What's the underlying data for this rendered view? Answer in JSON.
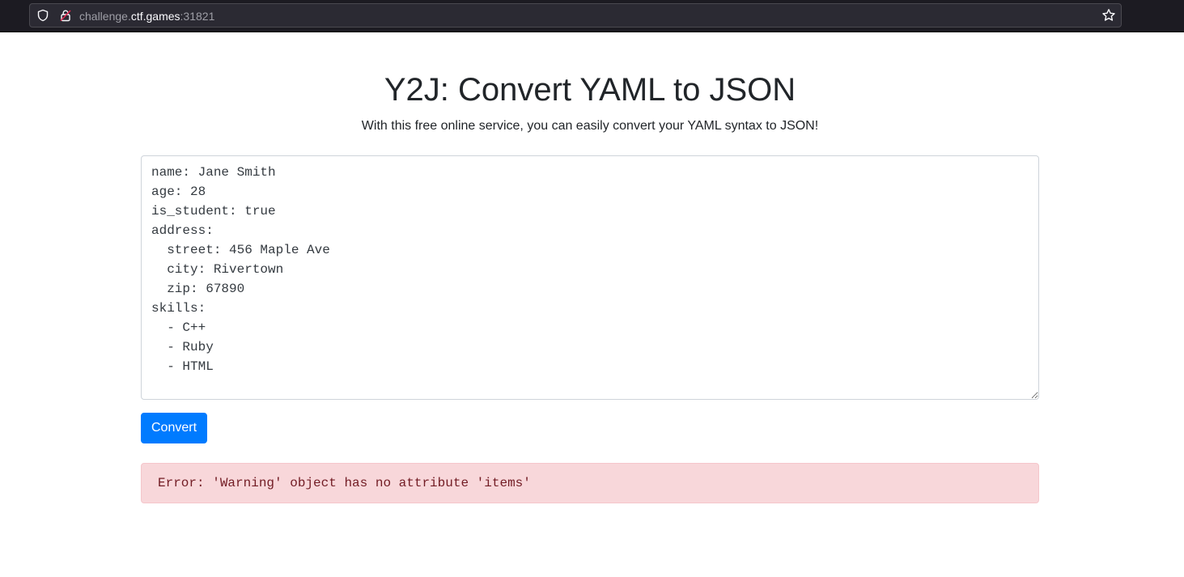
{
  "browser": {
    "url_prefix": "challenge.",
    "url_host": "ctf.games",
    "url_port": ":31821",
    "icons": [
      "shield-icon",
      "lock-icon",
      "bookmark-star-icon"
    ]
  },
  "main": {
    "title": "Y2J: Convert YAML to JSON",
    "subtitle": "With this free online service, you can easily convert your YAML syntax to JSON!",
    "yaml_value": "name: Jane Smith\nage: 28\nis_student: true\naddress:\n  street: 456 Maple Ave\n  city: Rivertown\n  zip: 67890\nskills:\n  - C++\n  - Ruby\n  - HTML",
    "convert_label": "Convert",
    "error_message": "Error: 'Warning' object has no attribute 'items'"
  },
  "colors": {
    "primary_button": "#007bff",
    "error_background": "#f8d7da",
    "error_text": "#721c24"
  }
}
